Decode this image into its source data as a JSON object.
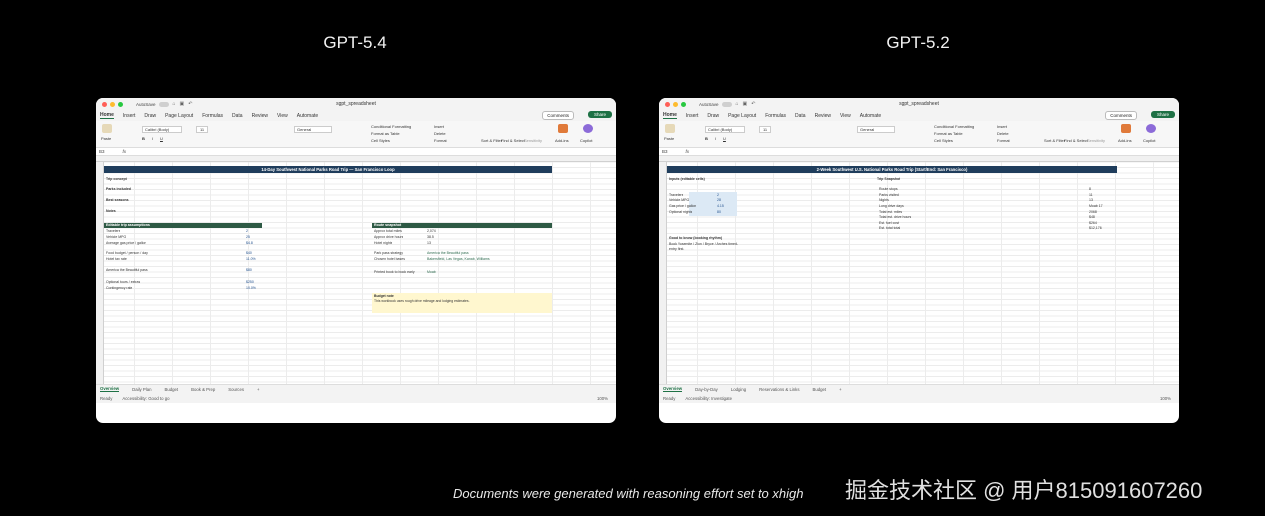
{
  "columns": [
    {
      "heading": "GPT-5.4",
      "window": {
        "autosave": "AutoSave",
        "docname": "sgpt_spreadsheet",
        "tabs": [
          "Home",
          "Insert",
          "Draw",
          "Page Layout",
          "Formulas",
          "Data",
          "Review",
          "View",
          "Automate"
        ],
        "comments": "Comments",
        "share": "Share",
        "font": "Calibri (Body)",
        "font_size": "11",
        "number_format": "General",
        "cond_format": "Conditional Formatting",
        "format_table": "Format as Table",
        "cell_styles": "Cell Styles",
        "insert": "Insert",
        "delete": "Delete",
        "format": "Format",
        "sort_filter": "Sort & Filter",
        "find_select": "Find & Select",
        "sensitivity": "Sensitivity",
        "addins": "Add-ins",
        "copilot": "Copilot",
        "paste": "Paste",
        "cellref": "B3",
        "banner": "14-Day Southwest National Parks Road Trip — San Francisco Loop",
        "sec1": "Editable trip assumptions",
        "sec2": "Route snapshot",
        "rows_left": [
          "Trip concept",
          "Parks included",
          "Best seasons",
          "Notes",
          "Travelers",
          "Vehicle MPG",
          "Average gas price / gallon",
          "Food budget / person / day",
          "Hotel tax rate",
          "America the Beautiful pass",
          "Optional tours / extras",
          "Contingency rate"
        ],
        "vals_left": [
          "2",
          "25",
          "$4.8",
          "$40",
          "11.0%",
          "$80",
          "$250",
          "10.0%"
        ],
        "rows_right": [
          "Approx total miles",
          "Approx drive hours",
          "Hotel nights",
          "Park pass strategy",
          "Chosen hotel bases",
          "Printed book to book early"
        ],
        "vals_right": [
          "2,074",
          "38.5",
          "13",
          "America the Beautiful pass",
          "Bakersfield, Las Vegas, Kanab, Williams",
          "Moab"
        ],
        "note_title": "Budget note",
        "note_text": "This workbook uses rough drive mileage and lodging estimates.",
        "sheets": [
          "Overview",
          "Daily Plan",
          "Budget",
          "Book & Prep",
          "Sources"
        ],
        "status": [
          "Ready",
          "Accessibility: Good to go"
        ],
        "zoom": "100%"
      }
    },
    {
      "heading": "GPT-5.2",
      "window": {
        "autosave": "AutoSave",
        "docname": "sgpt_spreadsheet",
        "tabs": [
          "Home",
          "Insert",
          "Draw",
          "Page Layout",
          "Formulas",
          "Data",
          "Review",
          "View",
          "Automate"
        ],
        "comments": "Comments",
        "share": "Share",
        "font": "Calibri (Body)",
        "font_size": "11",
        "number_format": "General",
        "cond_format": "Conditional Formatting",
        "format_table": "Format as Table",
        "cell_styles": "Cell Styles",
        "insert": "Insert",
        "delete": "Delete",
        "format": "Format",
        "sort_filter": "Sort & Filter",
        "find_select": "Find & Select",
        "sensitivity": "Sensitivity",
        "addins": "Add-ins",
        "copilot": "Copilot",
        "paste": "Paste",
        "cellref": "B3",
        "banner": "2-Week Southwest U.S. National Parks Road Trip (Start/End: San Francisco)",
        "sec1": "Inputs (editable cells)",
        "sec2": "Trip Snapshot",
        "rows_left": [
          "Travelers",
          "Vehicle MPG",
          "Gas price / gallon",
          "Optional nights"
        ],
        "vals_left": [
          "2",
          "28",
          "4.15",
          "80"
        ],
        "rows_right": [
          "Route stops",
          "Parks visited",
          "Nights",
          "Long drive days",
          "Total est. miles",
          "Total est. drive hours",
          "Est. fuel cost",
          "Est. total total"
        ],
        "vals_right": [
          "8",
          "11",
          "13",
          "Moab 17",
          "2068",
          "$48",
          "$264",
          "$12,176"
        ],
        "note_title": "Good to know (booking rhythm)",
        "note_text": "Book Yosemite / Zion / Bryce / Arches timed-entry first.",
        "sheets": [
          "Overview",
          "Day-by-Day",
          "Lodging",
          "Reservations & Links",
          "Budget"
        ],
        "status": [
          "Ready",
          "Accessibility: Investigate"
        ],
        "zoom": "100%"
      }
    }
  ],
  "caption": "Documents were generated with reasoning effort set to xhigh",
  "watermark": "掘金技术社区 @ 用户815091607260"
}
